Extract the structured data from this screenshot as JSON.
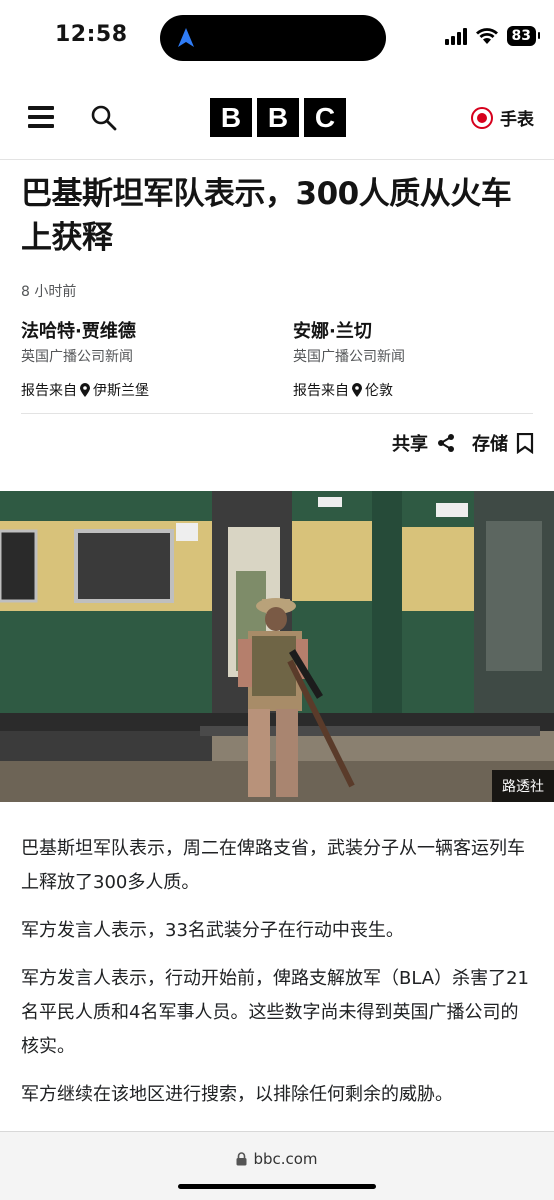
{
  "status_bar": {
    "time": "12:58",
    "battery": "83",
    "icons": [
      "location-arrow-icon",
      "signal-icon",
      "wifi-icon",
      "battery-icon"
    ]
  },
  "header": {
    "logo_letters": [
      "B",
      "B",
      "C"
    ],
    "watch_label": "手表",
    "icons": [
      "menu-icon",
      "search-icon",
      "live-icon"
    ]
  },
  "article": {
    "headline": "巴基斯坦军队表示，300人质从火车上获释",
    "timestamp": "8 小时前",
    "bylines": [
      {
        "name": "法哈特·贾维德",
        "org": "英国广播公司新闻",
        "loc_prefix": "报告来自",
        "loc": "伊斯兰堡"
      },
      {
        "name": "安娜·兰切",
        "org": "英国广播公司新闻",
        "loc_prefix": "报告来自",
        "loc": "伦敦"
      }
    ],
    "actions": {
      "share": "共享",
      "save": "存储"
    },
    "image": {
      "credit": "路透社"
    },
    "paragraphs": [
      "巴基斯坦军队表示，周二在俾路支省，武装分子从一辆客运列车上释放了300多人质。",
      "军方发言人表示，33名武装分子在行动中丧生。",
      "军方发言人表示，行动开始前，俾路支解放军（BLA）杀害了21名平民人质和4名军事人员。这些数字尚未得到英国广播公司的核实。",
      "军方继续在该地区进行搜索，以排除任何剩余的威胁。"
    ]
  },
  "browser": {
    "url": "bbc.com"
  },
  "colors": {
    "accent_red": "#d6001c",
    "train_green": "#2f5a43",
    "train_yellow": "#d8c27a"
  }
}
